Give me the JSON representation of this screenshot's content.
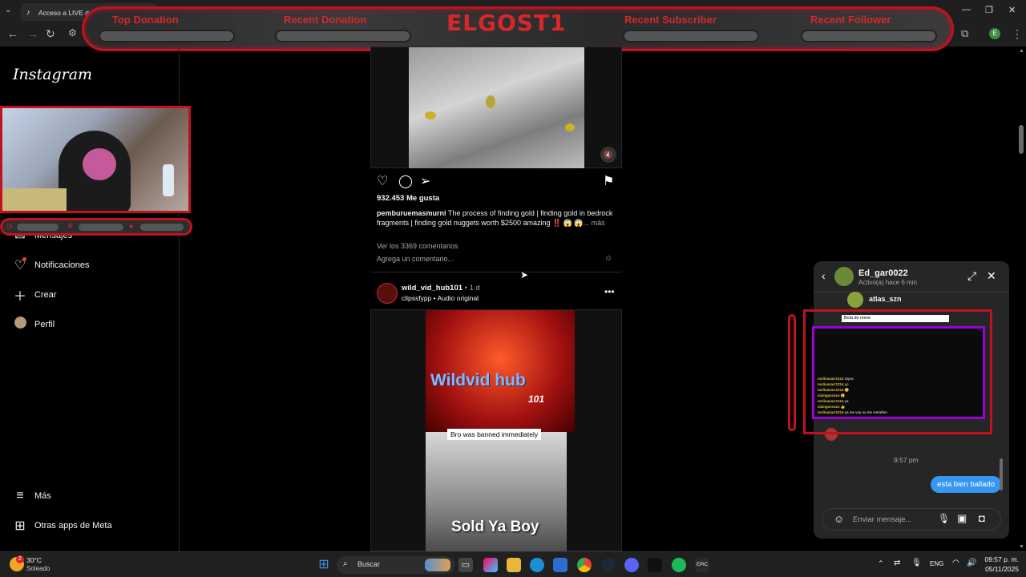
{
  "browser": {
    "tab_title": "Acceso a LIVE de TikTok"
  },
  "overlay": {
    "top_donation": "Top Donation",
    "recent_donation": "Recent Donation",
    "brand": "ELGOST1",
    "recent_subscriber": "Recent Subscriber",
    "recent_follower": "Recent Follower"
  },
  "sidebar": {
    "logo": "Instagram",
    "items": [
      {
        "label": "Mensajes",
        "icon": "messenger-icon"
      },
      {
        "label": "Notificaciones",
        "icon": "heart-icon"
      },
      {
        "label": "Crear",
        "icon": "plus-icon"
      },
      {
        "label": "Perfil",
        "icon": "avatar"
      }
    ],
    "bottom": [
      {
        "label": "Más",
        "icon": "menu-icon"
      },
      {
        "label": "Otras apps de Meta",
        "icon": "meta-apps-icon"
      }
    ]
  },
  "post1": {
    "likes": "932.453 Me gusta",
    "username": "pemburuemasmurni",
    "caption": "The process of finding gold | finding gold in bedrock fragments | finding gold nuggets worth $2500 amazing ‼️ 😱",
    "caption_more": "😱... más",
    "comments_link": "Ver los 3369 comentarios",
    "comment_placeholder": "Agrega un comentario..."
  },
  "post2": {
    "username": "wild_vid_hub101",
    "age": "• 1 d",
    "audio": "clipssfypp • Audio original",
    "overlay_title": "Wildvid hub",
    "overlay_num": "101",
    "banner": "Bro was banned immediately",
    "bottom_text": "Sold Ya Boy"
  },
  "chat": {
    "name": "Ed_gar0022",
    "status": "Activo(a) hace 6 min",
    "shared_user": "atlas_szn",
    "time": "9:57 pm",
    "message": "esta bien ballado",
    "input_placeholder": "Enviar mensaje..."
  },
  "obs": {
    "title": "Bola de nieve",
    "lines": [
      {
        "user": "mclinazarr1214",
        "text": "rayos"
      },
      {
        "user": "mclinazarr1214",
        "text": "yo"
      },
      {
        "user": "mclinazarr1214",
        "text": "🙂"
      },
      {
        "user": "sizingursozo",
        "text": "😮"
      },
      {
        "user": "mclinazarr1214",
        "text": "ya"
      },
      {
        "user": "sizingursozo",
        "text": "👍"
      },
      {
        "user": "mclinazarr1214",
        "text": "ya me voy no me extrañen"
      }
    ]
  },
  "taskbar": {
    "weather_temp": "30°C",
    "weather_desc": "Soleado",
    "weather_badge": "2",
    "search": "Buscar",
    "lang": "ENG",
    "time": "09:57 p. m.",
    "date": "05/11/2025"
  },
  "colors": {
    "overlay_red": "#c1121f",
    "ig_blue": "#3797f0",
    "obs_purple": "#9b00d9"
  }
}
